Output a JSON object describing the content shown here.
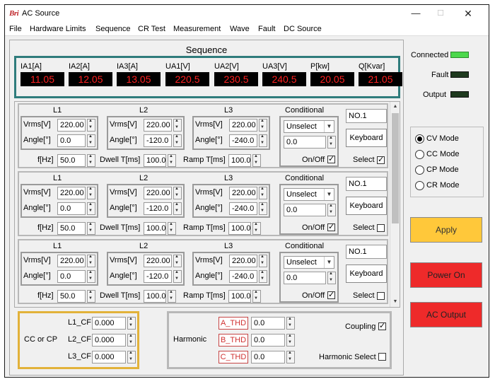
{
  "window": {
    "app_logo": "Bri",
    "title": "AC Source",
    "minimize": "—",
    "maximize": "☐",
    "close": "✕"
  },
  "menu": [
    "File",
    "Hardware Limits",
    "Sequence",
    "CR Test",
    "Measurement",
    "Wave",
    "Fault",
    "DC Source"
  ],
  "sequence_title": "Sequence",
  "meters": [
    {
      "label": "IA1[A]",
      "value": "11.05"
    },
    {
      "label": "IA2[A]",
      "value": "12.05"
    },
    {
      "label": "IA3[A]",
      "value": "13.05"
    },
    {
      "label": "UA1[V]",
      "value": "220.5"
    },
    {
      "label": "UA2[V]",
      "value": "230.5"
    },
    {
      "label": "UA3[V]",
      "value": "240.5"
    },
    {
      "label": "P[kw]",
      "value": "20.05"
    },
    {
      "label": "Q[Kvar]",
      "value": "21.05"
    }
  ],
  "row_labels": {
    "l1": "L1",
    "l2": "L2",
    "l3": "L3",
    "conditional": "Conditional",
    "vrms": "Vrms[V]",
    "angle": "Angle[°]",
    "freq": "f[Hz]",
    "dwell": "Dwell T[ms]",
    "ramp": "Ramp T[ms]",
    "onoff": "On/Off",
    "keyboard": "Keyboard",
    "select": "Select"
  },
  "rows": [
    {
      "no": "NO.1",
      "l1_vrms": "220.00",
      "l1_angle": "0.0",
      "l2_vrms": "220.00",
      "l2_angle": "-120.0",
      "l3_vrms": "220.00",
      "l3_angle": "-240.0",
      "freq": "50.0",
      "dwell": "100.0",
      "ramp": "100.0",
      "cond_select": "Unselect",
      "cond_value": "0.0",
      "onoff": true,
      "selected": true
    },
    {
      "no": "NO.1",
      "l1_vrms": "220.00",
      "l1_angle": "0.0",
      "l2_vrms": "220.00",
      "l2_angle": "-120.0",
      "l3_vrms": "220.00",
      "l3_angle": "-240.0",
      "freq": "50.0",
      "dwell": "100.0",
      "ramp": "100.0",
      "cond_select": "Unselect",
      "cond_value": "0.0",
      "onoff": true,
      "selected": false
    },
    {
      "no": "NO.1",
      "l1_vrms": "220.00",
      "l1_angle": "0.0",
      "l2_vrms": "220.00",
      "l2_angle": "-120.0",
      "l3_vrms": "220.00",
      "l3_angle": "-240.0",
      "freq": "50.0",
      "dwell": "100.0",
      "ramp": "100.0",
      "cond_select": "Unselect",
      "cond_value": "0.0",
      "onoff": true,
      "selected": false
    }
  ],
  "cf": {
    "title": "CC or CP",
    "l1_label": "L1_CF",
    "l1": "0.000",
    "l2_label": "L2_CF",
    "l2": "0.000",
    "l3_label": "L3_CF",
    "l3": "0.000"
  },
  "harmonic": {
    "title": "Harmonic",
    "a_label": "A_THD",
    "a": "0.0",
    "b_label": "B_THD",
    "b": "0.0",
    "c_label": "C_THD",
    "c": "0.0",
    "coupling": "Coupling",
    "coupling_on": true,
    "harm_select": "Harmonic Select",
    "harm_select_on": false
  },
  "status": {
    "connected": "Connected",
    "fault": "Fault",
    "output": "Output",
    "connected_on": true,
    "fault_on": false,
    "output_on": false
  },
  "modes": {
    "cv": "CV Mode",
    "cc": "CC Mode",
    "cp": "CP Mode",
    "cr": "CR Mode",
    "selected": "cv"
  },
  "buttons": {
    "apply": "Apply",
    "power_on": "Power On",
    "ac_output": "AC Output"
  },
  "colors": {
    "meter_text": "#ff2020",
    "meter_border": "#2f7c7c",
    "apply": "#ffc83a",
    "power": "#ee2a2a",
    "cf_border": "#e2b23a",
    "led_on": "#4cd84c",
    "led_off": "#1f3a1f"
  }
}
